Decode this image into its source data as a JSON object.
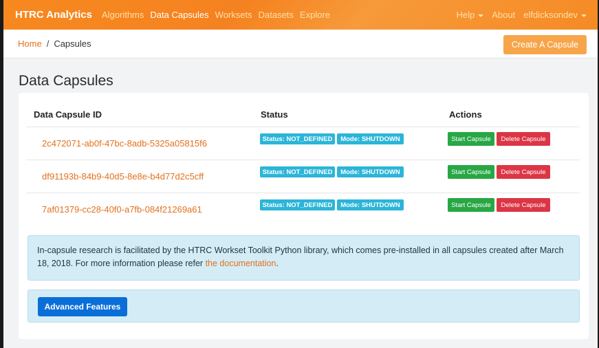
{
  "navbar": {
    "brand": "HTRC Analytics",
    "links": [
      "Algorithms",
      "Data Capsules",
      "Worksets",
      "Datasets",
      "Explore"
    ],
    "active": "Data Capsules",
    "help_label": "Help",
    "about_label": "About",
    "user_label": "elfdicksondev"
  },
  "breadcrumb": {
    "home": "Home",
    "separator": "/",
    "current": "Capsules"
  },
  "create_button": "Create A Capsule",
  "page_title": "Data Capsules",
  "table": {
    "headers": [
      "Data Capsule ID",
      "Status",
      "Actions"
    ],
    "rows": [
      {
        "id": "2c472071-ab0f-47bc-8adb-5325a05815f6",
        "status": "Status: NOT_DEFINED",
        "mode": "Mode: SHUTDOWN",
        "start": "Start Capsule",
        "delete": "Delete Capsule"
      },
      {
        "id": "df91193b-84b9-40d5-8e8e-b4d77d2c5cff",
        "status": "Status: NOT_DEFINED",
        "mode": "Mode: SHUTDOWN",
        "start": "Start Capsule",
        "delete": "Delete Capsule"
      },
      {
        "id": "7af01379-cc28-40f0-a7fb-084f21269a61",
        "status": "Status: NOT_DEFINED",
        "mode": "Mode: SHUTDOWN",
        "start": "Start Capsule",
        "delete": "Delete Capsule"
      }
    ]
  },
  "info": {
    "text": "In-capsule research is facilitated by the HTRC Workset Toolkit Python library, which comes pre-installed in all capsules created after March 18, 2018. For more information please refer ",
    "link_text": "the documentation",
    "suffix": "."
  },
  "advanced_button": "Advanced Features",
  "colors": {
    "brand_orange": "#f58220",
    "link_orange": "#e2711d",
    "badge_cyan": "#2bb5d8",
    "start_green": "#28a745",
    "delete_red": "#dc3545",
    "primary_blue": "#0a6ed8",
    "info_bg": "#d4ecf6"
  },
  "icons": {
    "dropdown_caret": "chevron-down-icon"
  }
}
